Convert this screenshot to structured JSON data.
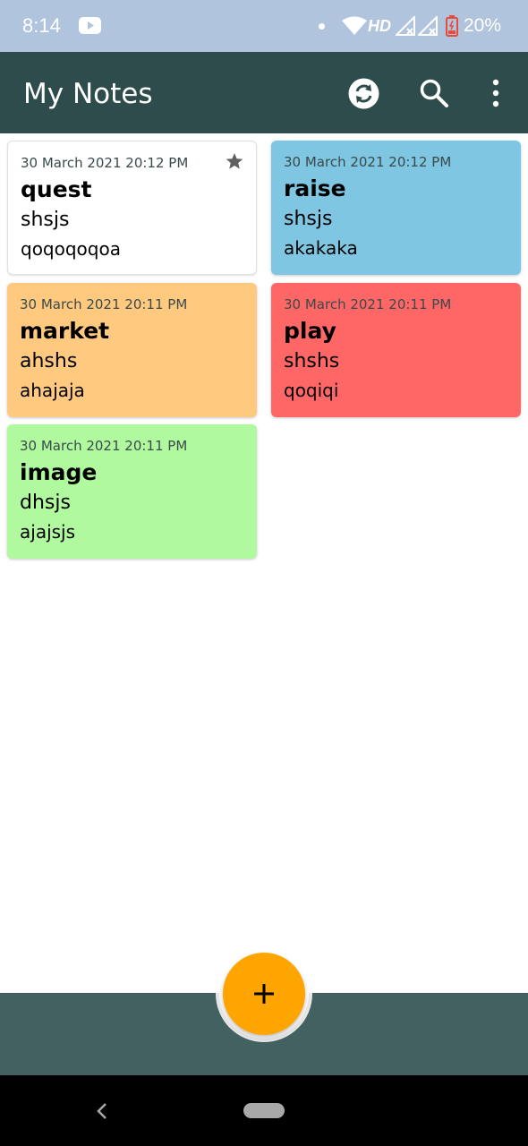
{
  "status_bar": {
    "time": "8:14",
    "network": "HD",
    "battery": "20%",
    "icons": [
      "youtube-icon",
      "dot",
      "wifi-icon",
      "signal-icon",
      "signal-icon",
      "battery-icon"
    ]
  },
  "app_bar": {
    "title": "My Notes",
    "actions": [
      "sync-icon",
      "search-icon",
      "more-vert-icon"
    ],
    "color": "#2e4c4b"
  },
  "notes": [
    {
      "date": "30 March 2021 20:12 PM",
      "title": "quest",
      "line1": "shsjs",
      "line2": "qoqoqoqoa",
      "color": "#ffffff",
      "starred": true
    },
    {
      "date": "30 March 2021 20:12 PM",
      "title": "raise",
      "line1": "shsjs",
      "line2": "akakaka",
      "color": "#7ec6e2",
      "starred": false
    },
    {
      "date": "30 March 2021 20:11 PM",
      "title": "market",
      "line1": "ahshs",
      "line2": "ahajaja",
      "color": "#ffca80",
      "starred": false
    },
    {
      "date": "30 March 2021 20:11 PM",
      "title": "play",
      "line1": "shshs",
      "line2": "qoqiqi",
      "color": "#ff6767",
      "starred": false
    },
    {
      "date": "30 March 2021 20:11 PM",
      "title": "image",
      "line1": "dhsjs",
      "line2": "ajajsjs",
      "color": "#b0f99e",
      "starred": false
    }
  ],
  "fab": {
    "icon": "plus-icon",
    "color": "#ffa502"
  },
  "bottom_bar": {
    "color": "#436160"
  },
  "nav": {
    "icons": [
      "back-icon",
      "home-pill"
    ]
  }
}
